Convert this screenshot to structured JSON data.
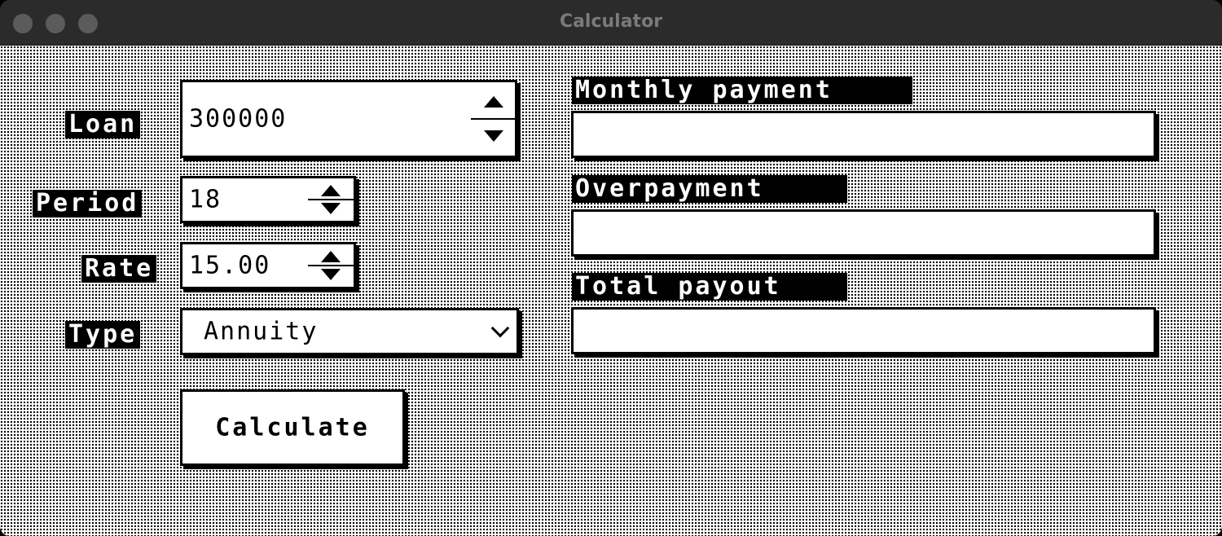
{
  "window": {
    "title": "Calculator"
  },
  "form": {
    "loan": {
      "label": "Loan",
      "value": "300000"
    },
    "period": {
      "label": "Period",
      "value": "18"
    },
    "rate": {
      "label": "Rate",
      "value": "15.00"
    },
    "type": {
      "label": "Type",
      "selected": "Annuity"
    },
    "calculate_label": "Calculate"
  },
  "results": {
    "monthly_payment": {
      "label": "Monthly payment",
      "value": ""
    },
    "overpayment": {
      "label": "Overpayment",
      "value": ""
    },
    "total_payout": {
      "label": "Total payout",
      "value": ""
    }
  },
  "icons": {
    "spin_up": "triangle-up-icon",
    "spin_down": "triangle-down-icon",
    "dropdown": "chevron-down-icon"
  }
}
